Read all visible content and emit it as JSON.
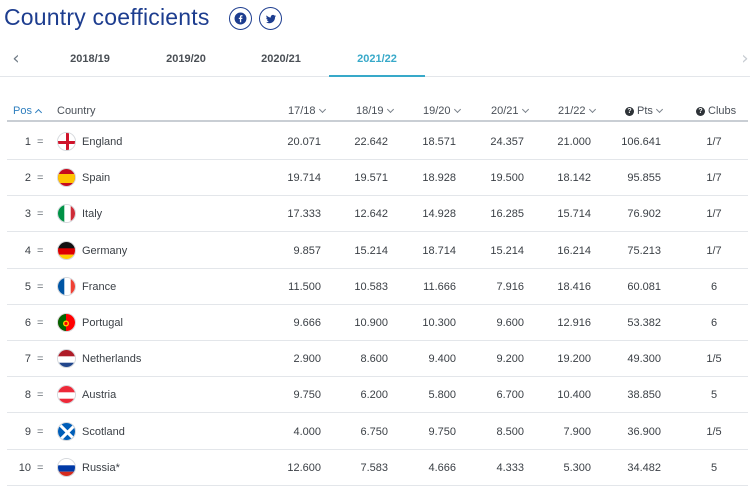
{
  "page": {
    "title": "Country coefficients",
    "share": [
      "facebook-icon",
      "twitter-icon"
    ]
  },
  "seasons": {
    "prev_arrow": "‹",
    "next_arrow": "›",
    "tabs": [
      "2018/19",
      "2019/20",
      "2020/21",
      "2021/22"
    ],
    "active": "2021/22"
  },
  "table": {
    "headers": {
      "pos": "Pos",
      "country": "Country",
      "c1718": "17/18",
      "c1819": "18/19",
      "c1920": "19/20",
      "c2021": "20/21",
      "c2122": "21/22",
      "pts": "Pts",
      "clubs": "Clubs"
    },
    "info_icon": "?",
    "rows": [
      {
        "pos": "1",
        "change": "=",
        "flag": "england",
        "country": "England",
        "s1718": "20.071",
        "s1819": "22.642",
        "s1920": "18.571",
        "s2021": "24.357",
        "s2122": "21.000",
        "pts": "106.641",
        "clubs": "1/7"
      },
      {
        "pos": "2",
        "change": "=",
        "flag": "spain",
        "country": "Spain",
        "s1718": "19.714",
        "s1819": "19.571",
        "s1920": "18.928",
        "s2021": "19.500",
        "s2122": "18.142",
        "pts": "95.855",
        "clubs": "1/7"
      },
      {
        "pos": "3",
        "change": "=",
        "flag": "italy",
        "country": "Italy",
        "s1718": "17.333",
        "s1819": "12.642",
        "s1920": "14.928",
        "s2021": "16.285",
        "s2122": "15.714",
        "pts": "76.902",
        "clubs": "1/7"
      },
      {
        "pos": "4",
        "change": "=",
        "flag": "germany",
        "country": "Germany",
        "s1718": "9.857",
        "s1819": "15.214",
        "s1920": "18.714",
        "s2021": "15.214",
        "s2122": "16.214",
        "pts": "75.213",
        "clubs": "1/7"
      },
      {
        "pos": "5",
        "change": "=",
        "flag": "france",
        "country": "France",
        "s1718": "11.500",
        "s1819": "10.583",
        "s1920": "11.666",
        "s2021": "7.916",
        "s2122": "18.416",
        "pts": "60.081",
        "clubs": "6"
      },
      {
        "pos": "6",
        "change": "=",
        "flag": "portugal",
        "country": "Portugal",
        "s1718": "9.666",
        "s1819": "10.900",
        "s1920": "10.300",
        "s2021": "9.600",
        "s2122": "12.916",
        "pts": "53.382",
        "clubs": "6"
      },
      {
        "pos": "7",
        "change": "=",
        "flag": "netherlands",
        "country": "Netherlands",
        "s1718": "2.900",
        "s1819": "8.600",
        "s1920": "9.400",
        "s2021": "9.200",
        "s2122": "19.200",
        "pts": "49.300",
        "clubs": "1/5"
      },
      {
        "pos": "8",
        "change": "=",
        "flag": "austria",
        "country": "Austria",
        "s1718": "9.750",
        "s1819": "6.200",
        "s1920": "5.800",
        "s2021": "6.700",
        "s2122": "10.400",
        "pts": "38.850",
        "clubs": "5"
      },
      {
        "pos": "9",
        "change": "=",
        "flag": "scotland",
        "country": "Scotland",
        "s1718": "4.000",
        "s1819": "6.750",
        "s1920": "9.750",
        "s2021": "8.500",
        "s2122": "7.900",
        "pts": "36.900",
        "clubs": "1/5"
      },
      {
        "pos": "10",
        "change": "=",
        "flag": "russia",
        "country": "Russia*",
        "s1718": "12.600",
        "s1819": "7.583",
        "s1920": "4.666",
        "s2021": "4.333",
        "s2122": "5.300",
        "pts": "34.482",
        "clubs": "5"
      }
    ]
  },
  "colors": {
    "title": "#1d3d8f",
    "active_tab": "#38a9c9",
    "sort_header": "#2f7fbf"
  }
}
